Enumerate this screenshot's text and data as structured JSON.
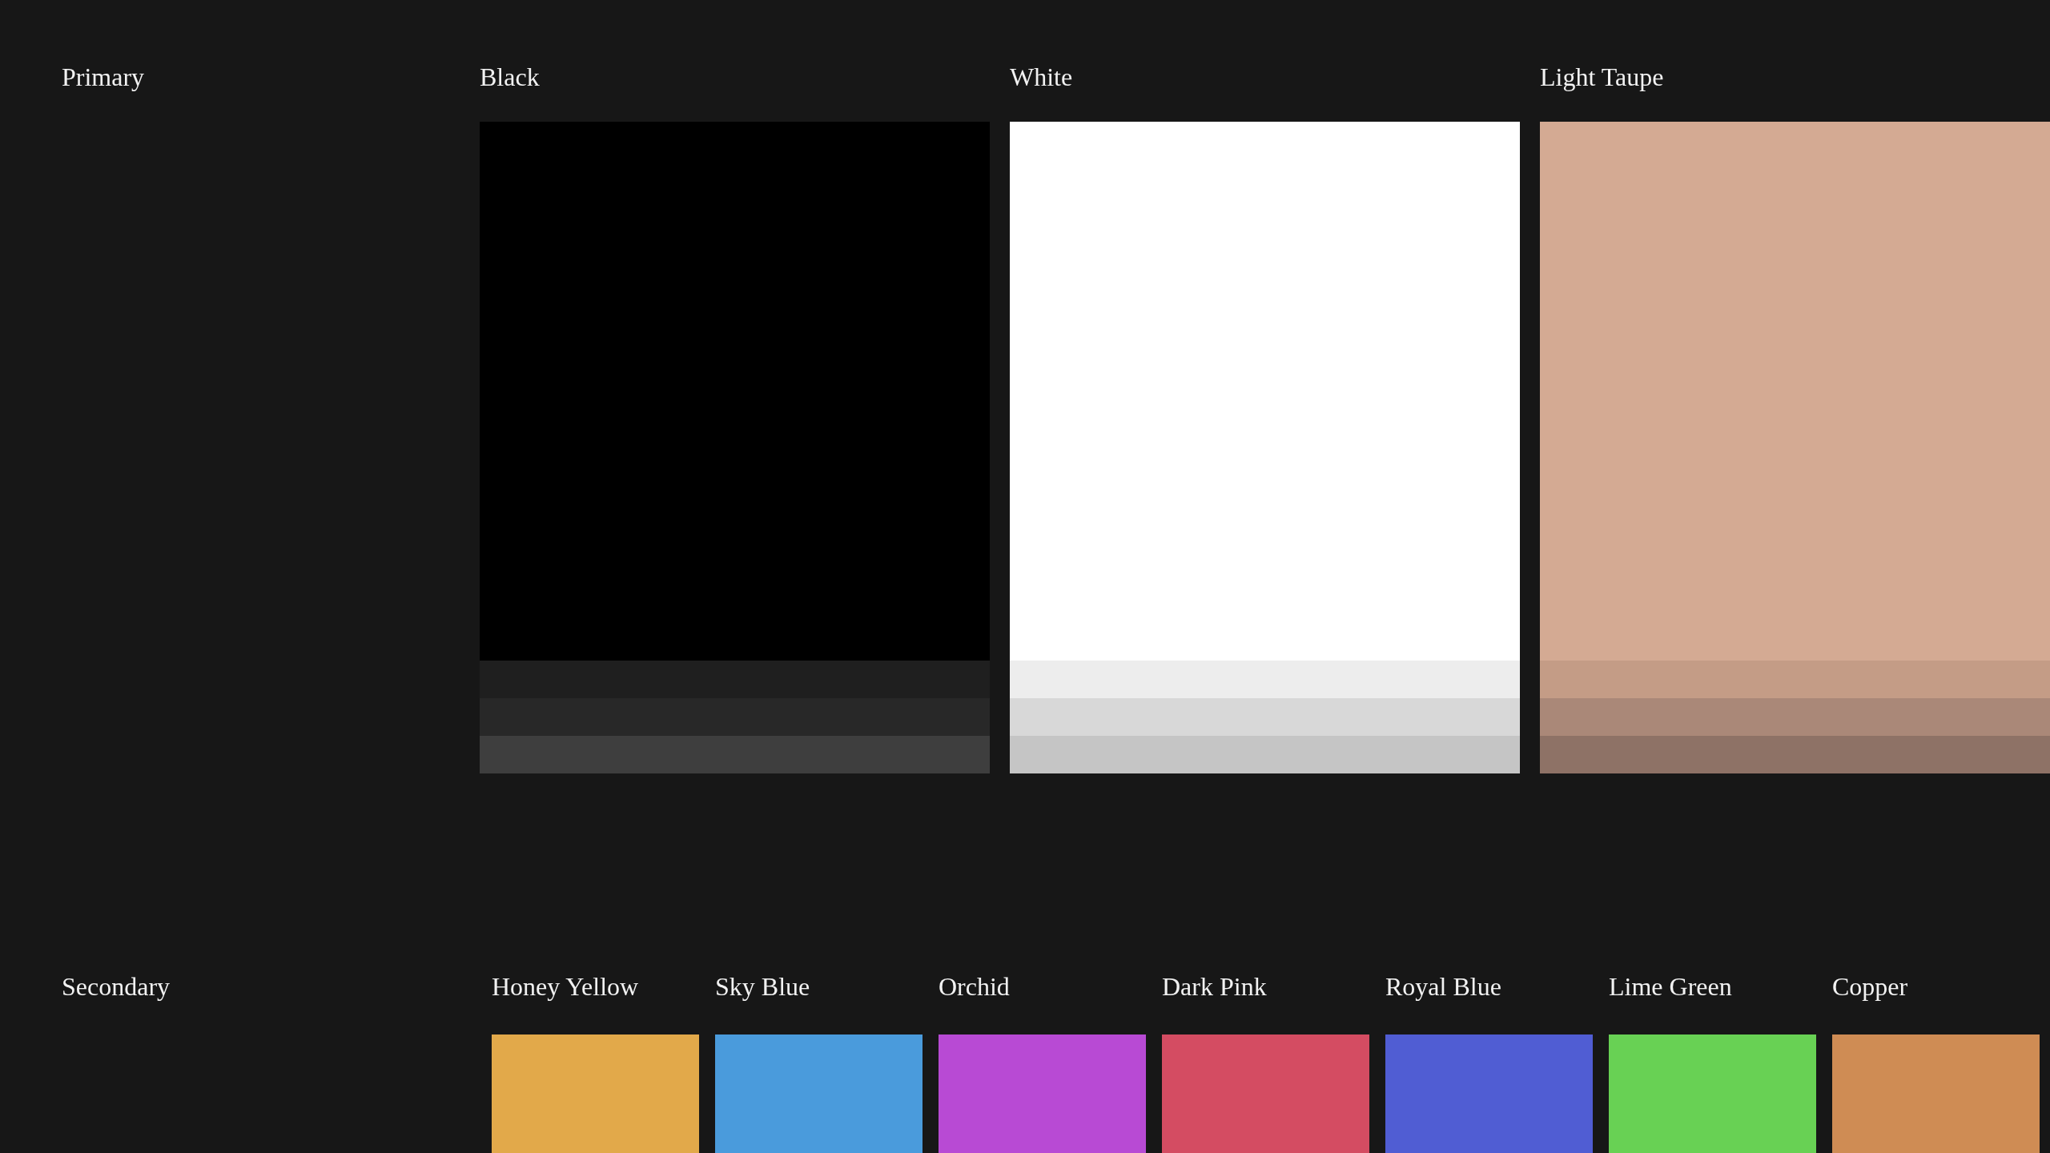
{
  "sections": [
    {
      "title": "Primary",
      "kind": "large",
      "swatches": [
        {
          "name": "Black",
          "color": "#000000",
          "shades": [
            {
              "color": "#1f1f1f"
            },
            {
              "color": "#282828"
            },
            {
              "color": "#3e3e3e"
            }
          ]
        },
        {
          "name": "White",
          "color": "#ffffff",
          "shades": [
            {
              "color": "#ededed"
            },
            {
              "color": "#d8d8d8"
            },
            {
              "color": "#c5c5c5"
            }
          ]
        },
        {
          "name": "Light Taupe",
          "color": "#d4aa93",
          "shades": [
            {
              "color": "#c49c86"
            },
            {
              "color": "#aa8878"
            },
            {
              "color": "#8e7266"
            }
          ]
        }
      ]
    },
    {
      "title": "Secondary",
      "kind": "small",
      "swatches": [
        {
          "name": "Honey Yellow",
          "color": "#e2a94a"
        },
        {
          "name": "Sky Blue",
          "color": "#4a9bdc"
        },
        {
          "name": "Orchid",
          "color": "#b84ad4"
        },
        {
          "name": "Dark Pink",
          "color": "#d44c62"
        },
        {
          "name": "Royal Blue",
          "color": "#505dd3"
        },
        {
          "name": "Lime Green",
          "color": "#68d154"
        },
        {
          "name": "Copper",
          "color": "#cf8c54"
        }
      ]
    }
  ]
}
